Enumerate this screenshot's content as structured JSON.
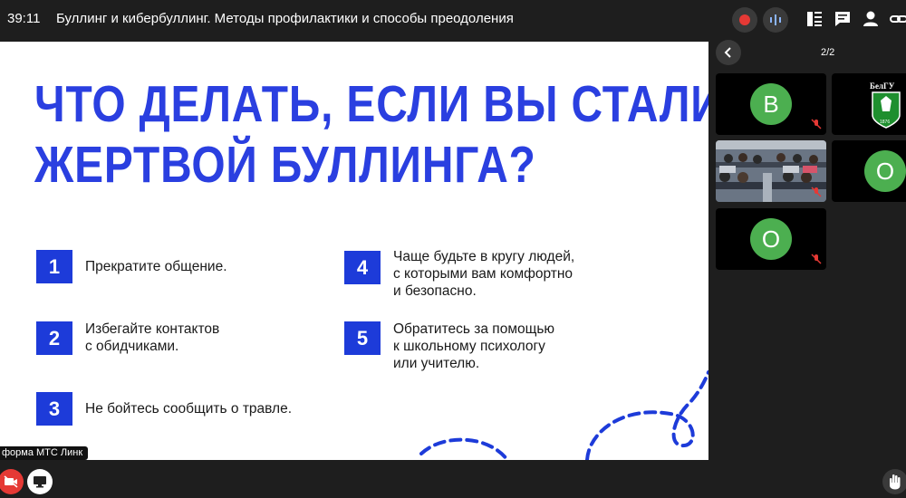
{
  "header": {
    "timer": "39:11",
    "title": "Буллинг и кибербуллинг. Методы профилактики и способы преодоления"
  },
  "slide": {
    "title_line1": "ЧТО ДЕЛАТЬ, ЕСЛИ ВЫ СТАЛИ",
    "title_line2": "ЖЕРТВОЙ БУЛЛИНГА?",
    "items": [
      {
        "num": "1",
        "text": "Прекратите общение."
      },
      {
        "num": "2",
        "text": "Избегайте контактов\nс обидчиками."
      },
      {
        "num": "3",
        "text": "Не бойтесь сообщить о травле."
      },
      {
        "num": "4",
        "text": "Чаще будьте в кругу людей,\nс которыми вам комфортно\nи безопасно."
      },
      {
        "num": "5",
        "text": "Обратитесь за помощью\nк школьному психологу\nили учителю."
      }
    ]
  },
  "sidebar": {
    "page_indicator": "2/2",
    "participants": [
      {
        "initial": "В",
        "color": "#4caf50"
      },
      {
        "initial": "О",
        "color": "#4caf50"
      },
      {
        "initial": "О",
        "color": "#4caf50"
      }
    ],
    "logo_text": "БелГУ",
    "logo_year": "1876"
  },
  "footer": {
    "platform_label": "форма МТС Линк"
  },
  "colors": {
    "accent": "#2a3fe0",
    "badge": "#1d3bd9",
    "avatar": "#4caf50",
    "record": "#e53935",
    "panel_bg": "#1e1e1e"
  },
  "icons": [
    "record-icon",
    "audio-wave-icon",
    "presentation-icon",
    "chat-icon",
    "person-icon",
    "link-icon",
    "chevron-left-icon",
    "mic-off-icon",
    "camera-off-icon",
    "screen-share-icon",
    "raise-hand-icon"
  ]
}
